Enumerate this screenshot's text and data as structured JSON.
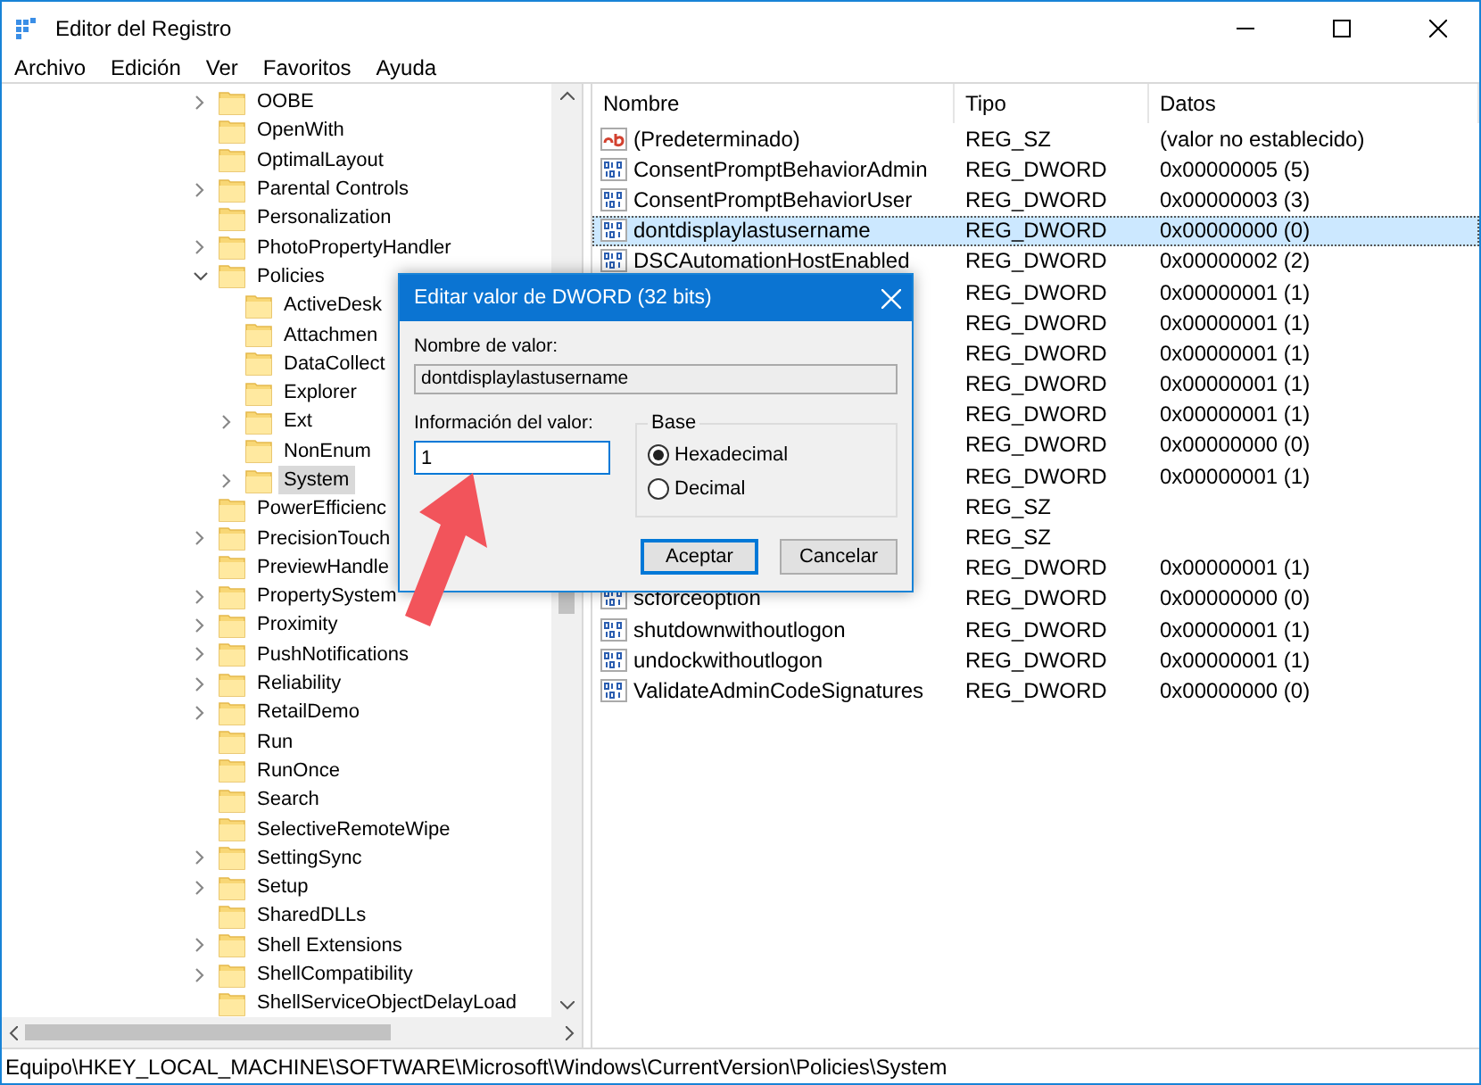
{
  "window": {
    "title": "Editor del Registro"
  },
  "menu": [
    "Archivo",
    "Edición",
    "Ver",
    "Favoritos",
    "Ayuda"
  ],
  "tree": {
    "items": [
      {
        "label": "OOBE",
        "kind": "collapsed",
        "selected": false
      },
      {
        "label": "OpenWith",
        "kind": "leaf",
        "selected": false
      },
      {
        "label": "OptimalLayout",
        "kind": "leaf",
        "selected": false
      },
      {
        "label": "Parental Controls",
        "kind": "collapsed",
        "selected": false
      },
      {
        "label": "Personalization",
        "kind": "leaf",
        "selected": false
      },
      {
        "label": "PhotoPropertyHandler",
        "kind": "collapsed",
        "selected": false
      },
      {
        "label": "Policies",
        "kind": "expanded",
        "selected": false,
        "children": [
          {
            "label": "ActiveDesk",
            "kind": "leaf",
            "selected": false
          },
          {
            "label": "Attachmen",
            "kind": "leaf",
            "selected": false
          },
          {
            "label": "DataCollect",
            "kind": "leaf",
            "selected": false
          },
          {
            "label": "Explorer",
            "kind": "leaf",
            "selected": false
          },
          {
            "label": "Ext",
            "kind": "collapsed",
            "selected": false
          },
          {
            "label": "NonEnum",
            "kind": "leaf",
            "selected": false
          },
          {
            "label": "System",
            "kind": "collapsed",
            "selected": true
          }
        ]
      },
      {
        "label": "PowerEfficienc",
        "kind": "leaf",
        "selected": false
      },
      {
        "label": "PrecisionTouch",
        "kind": "collapsed",
        "selected": false
      },
      {
        "label": "PreviewHandle",
        "kind": "leaf",
        "selected": false
      },
      {
        "label": "PropertySystem",
        "kind": "collapsed",
        "selected": false
      },
      {
        "label": "Proximity",
        "kind": "collapsed",
        "selected": false
      },
      {
        "label": "PushNotifications",
        "kind": "collapsed",
        "selected": false
      },
      {
        "label": "Reliability",
        "kind": "collapsed",
        "selected": false
      },
      {
        "label": "RetailDemo",
        "kind": "collapsed",
        "selected": false
      },
      {
        "label": "Run",
        "kind": "leaf",
        "selected": false
      },
      {
        "label": "RunOnce",
        "kind": "leaf",
        "selected": false
      },
      {
        "label": "Search",
        "kind": "leaf",
        "selected": false
      },
      {
        "label": "SelectiveRemoteWipe",
        "kind": "leaf",
        "selected": false
      },
      {
        "label": "SettingSync",
        "kind": "collapsed",
        "selected": false
      },
      {
        "label": "Setup",
        "kind": "collapsed",
        "selected": false
      },
      {
        "label": "SharedDLLs",
        "kind": "leaf",
        "selected": false
      },
      {
        "label": "Shell Extensions",
        "kind": "collapsed",
        "selected": false
      },
      {
        "label": "ShellCompatibility",
        "kind": "collapsed",
        "selected": false
      },
      {
        "label": "ShellServiceObjectDelayLoad",
        "kind": "leaf",
        "selected": false
      }
    ]
  },
  "values": {
    "columns": [
      "Nombre",
      "Tipo",
      "Datos"
    ],
    "rows": [
      {
        "kind": "string",
        "name": "(Predeterminado)",
        "type": "REG_SZ",
        "data": "(valor no establecido)",
        "selected": false
      },
      {
        "kind": "dword",
        "name": "ConsentPromptBehaviorAdmin",
        "type": "REG_DWORD",
        "data": "0x00000005 (5)",
        "selected": false
      },
      {
        "kind": "dword",
        "name": "ConsentPromptBehaviorUser",
        "type": "REG_DWORD",
        "data": "0x00000003 (3)",
        "selected": false
      },
      {
        "kind": "dword",
        "name": "dontdisplaylastusername",
        "type": "REG_DWORD",
        "data": "0x00000000 (0)",
        "selected": true
      },
      {
        "kind": "dword",
        "name": "DSCAutomationHostEnabled",
        "type": "REG_DWORD",
        "data": "0x00000002 (2)",
        "selected": false
      },
      {
        "type": "REG_DWORD",
        "data": "0x00000001 (1)",
        "selected": false
      },
      {
        "type": "REG_DWORD",
        "data": "0x00000001 (1)",
        "selected": false
      },
      {
        "type": "REG_DWORD",
        "data": "0x00000001 (1)",
        "selected": false
      },
      {
        "type": "REG_DWORD",
        "data": "0x00000001 (1)",
        "selected": false
      },
      {
        "type": "REG_DWORD",
        "data": "0x00000001 (1)",
        "selected": false
      },
      {
        "type": "REG_DWORD",
        "data": "0x00000000 (0)",
        "selected": false
      },
      {
        "type": "REG_DWORD",
        "data": "0x00000001 (1)",
        "selected": false
      },
      {
        "type": "REG_SZ",
        "selected": false
      },
      {
        "type": "REG_SZ",
        "selected": false
      },
      {
        "type": "REG_DWORD",
        "data": "0x00000001 (1)",
        "selected": false
      },
      {
        "kind": "dword",
        "name": "scforceoption",
        "type": "REG_DWORD",
        "data": "0x00000000 (0)",
        "selected": false
      },
      {
        "kind": "dword",
        "name": "shutdownwithoutlogon",
        "type": "REG_DWORD",
        "data": "0x00000001 (1)",
        "selected": false
      },
      {
        "kind": "dword",
        "name": "undockwithoutlogon",
        "type": "REG_DWORD",
        "data": "0x00000001 (1)",
        "selected": false
      },
      {
        "kind": "dword",
        "name": "ValidateAdminCodeSignatures",
        "type": "REG_DWORD",
        "data": "0x00000000 (0)",
        "selected": false
      }
    ]
  },
  "dialog": {
    "title": "Editar valor de DWORD (32 bits)",
    "name_label": "Nombre de valor:",
    "name_value": "dontdisplaylastusername",
    "data_label": "Información del valor:",
    "data_value": "1",
    "base_label": "Base",
    "bases": [
      {
        "label": "Hexadecimal",
        "selected": true
      },
      {
        "label": "Decimal",
        "selected": false
      }
    ],
    "buttons": [
      {
        "label": "Aceptar",
        "default": true
      },
      {
        "label": "Cancelar",
        "default": false
      }
    ]
  },
  "status_bar": "Equipo\\HKEY_LOCAL_MACHINE\\SOFTWARE\\Microsoft\\Windows\\CurrentVersion\\Policies\\System"
}
